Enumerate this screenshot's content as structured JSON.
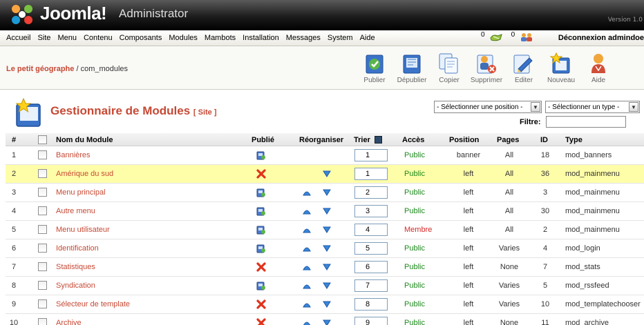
{
  "header": {
    "brand": "Joomla!",
    "brand_suffix": "Administrator",
    "version": "Version 1.0"
  },
  "menubar": {
    "items": [
      "Accueil",
      "Site",
      "Menu",
      "Contenu",
      "Composants",
      "Modules",
      "Mambots",
      "Installation",
      "Messages",
      "System",
      "Aide"
    ],
    "messages_count": "0",
    "users_count": "0",
    "logout": "Déconnexion admindoe"
  },
  "breadcrumb": {
    "site": "Le petit géographe",
    "separator": " / ",
    "page": "com_modules"
  },
  "toolbar": {
    "buttons": [
      {
        "label": "Publier",
        "icon": "publish-icon"
      },
      {
        "label": "Dépublier",
        "icon": "unpublish-icon"
      },
      {
        "label": "Copier",
        "icon": "copy-icon"
      },
      {
        "label": "Supprimer",
        "icon": "delete-icon"
      },
      {
        "label": "Editer",
        "icon": "edit-icon"
      },
      {
        "label": "Nouveau",
        "icon": "new-icon"
      },
      {
        "label": "Aide",
        "icon": "help-icon"
      }
    ]
  },
  "page": {
    "title": "Gestionnaire de Modules",
    "subtitle": "[ Site ]",
    "position_filter": "- Sélectionner une position -",
    "type_filter": "- Sélectionner un type -",
    "filter_label": "Filtre:",
    "filter_value": ""
  },
  "table": {
    "headers": {
      "num": "#",
      "name": "Nom du Module",
      "published": "Publié",
      "reorder": "Réorganiser",
      "order": "Trier",
      "access": "Accès",
      "position": "Position",
      "pages": "Pages",
      "id": "ID",
      "type": "Type"
    },
    "rows": [
      {
        "num": "1",
        "name": "Bannières",
        "published": true,
        "order": "1",
        "access": "Public",
        "position": "banner",
        "pages": "All",
        "id": "18",
        "type": "mod_banners",
        "up": false,
        "down": false,
        "highlight": false
      },
      {
        "num": "2",
        "name": "Amérique du sud",
        "published": false,
        "order": "1",
        "access": "Public",
        "position": "left",
        "pages": "All",
        "id": "36",
        "type": "mod_mainmenu",
        "up": false,
        "down": true,
        "highlight": true
      },
      {
        "num": "3",
        "name": "Menu principal",
        "published": true,
        "order": "2",
        "access": "Public",
        "position": "left",
        "pages": "All",
        "id": "3",
        "type": "mod_mainmenu",
        "up": true,
        "down": true,
        "highlight": false
      },
      {
        "num": "4",
        "name": "Autre menu",
        "published": true,
        "order": "3",
        "access": "Public",
        "position": "left",
        "pages": "All",
        "id": "30",
        "type": "mod_mainmenu",
        "up": true,
        "down": true,
        "highlight": false
      },
      {
        "num": "5",
        "name": "Menu utilisateur",
        "published": true,
        "order": "4",
        "access": "Membre",
        "position": "left",
        "pages": "All",
        "id": "2",
        "type": "mod_mainmenu",
        "up": true,
        "down": true,
        "highlight": false
      },
      {
        "num": "6",
        "name": "Identification",
        "published": true,
        "order": "5",
        "access": "Public",
        "position": "left",
        "pages": "Varies",
        "id": "4",
        "type": "mod_login",
        "up": true,
        "down": true,
        "highlight": false
      },
      {
        "num": "7",
        "name": "Statistiques",
        "published": false,
        "order": "6",
        "access": "Public",
        "position": "left",
        "pages": "None",
        "id": "7",
        "type": "mod_stats",
        "up": true,
        "down": true,
        "highlight": false
      },
      {
        "num": "8",
        "name": "Syndication",
        "published": true,
        "order": "7",
        "access": "Public",
        "position": "left",
        "pages": "Varies",
        "id": "5",
        "type": "mod_rssfeed",
        "up": true,
        "down": true,
        "highlight": false
      },
      {
        "num": "9",
        "name": "Sélecteur de template",
        "published": false,
        "order": "8",
        "access": "Public",
        "position": "left",
        "pages": "Varies",
        "id": "10",
        "type": "mod_templatechooser",
        "up": true,
        "down": true,
        "highlight": false
      },
      {
        "num": "10",
        "name": "Archive",
        "published": false,
        "order": "9",
        "access": "Public",
        "position": "left",
        "pages": "None",
        "id": "11",
        "type": "mod_archive",
        "up": true,
        "down": true,
        "highlight": false
      }
    ]
  }
}
